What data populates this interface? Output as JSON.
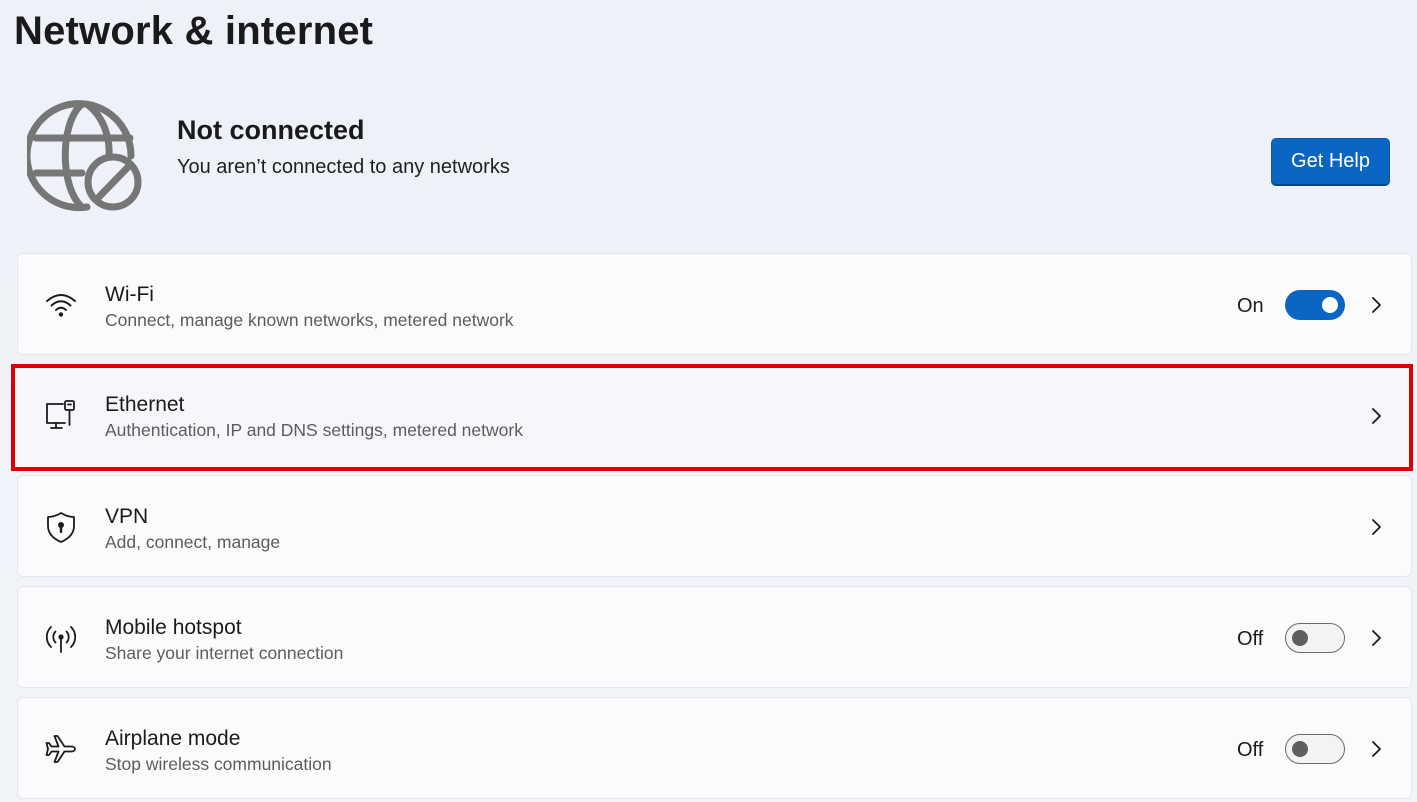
{
  "page": {
    "title": "Network & internet"
  },
  "status": {
    "icon": "globe-disconnected-icon",
    "title": "Not connected",
    "subtitle": "You aren’t connected to any networks",
    "help_button": "Get Help"
  },
  "cards": [
    {
      "key": "wifi",
      "icon": "wifi-icon",
      "title": "Wi-Fi",
      "subtitle": "Connect, manage known networks, metered network",
      "state_label": "On",
      "toggle_on": true
    },
    {
      "key": "ethernet",
      "icon": "ethernet-icon",
      "title": "Ethernet",
      "subtitle": "Authentication, IP and DNS settings, metered network",
      "highlighted": true
    },
    {
      "key": "vpn",
      "icon": "vpn-shield-icon",
      "title": "VPN",
      "subtitle": "Add, connect, manage"
    },
    {
      "key": "hotspot",
      "icon": "hotspot-icon",
      "title": "Mobile hotspot",
      "subtitle": "Share your internet connection",
      "state_label": "Off",
      "toggle_on": false
    },
    {
      "key": "airplane",
      "icon": "airplane-icon",
      "title": "Airplane mode",
      "subtitle": "Stop wireless communication",
      "state_label": "Off",
      "toggle_on": false
    }
  ],
  "colors": {
    "accent": "#0a66c2",
    "highlight_border": "#e00000",
    "background": "#eef2f8",
    "card": "#fbfbfd"
  }
}
